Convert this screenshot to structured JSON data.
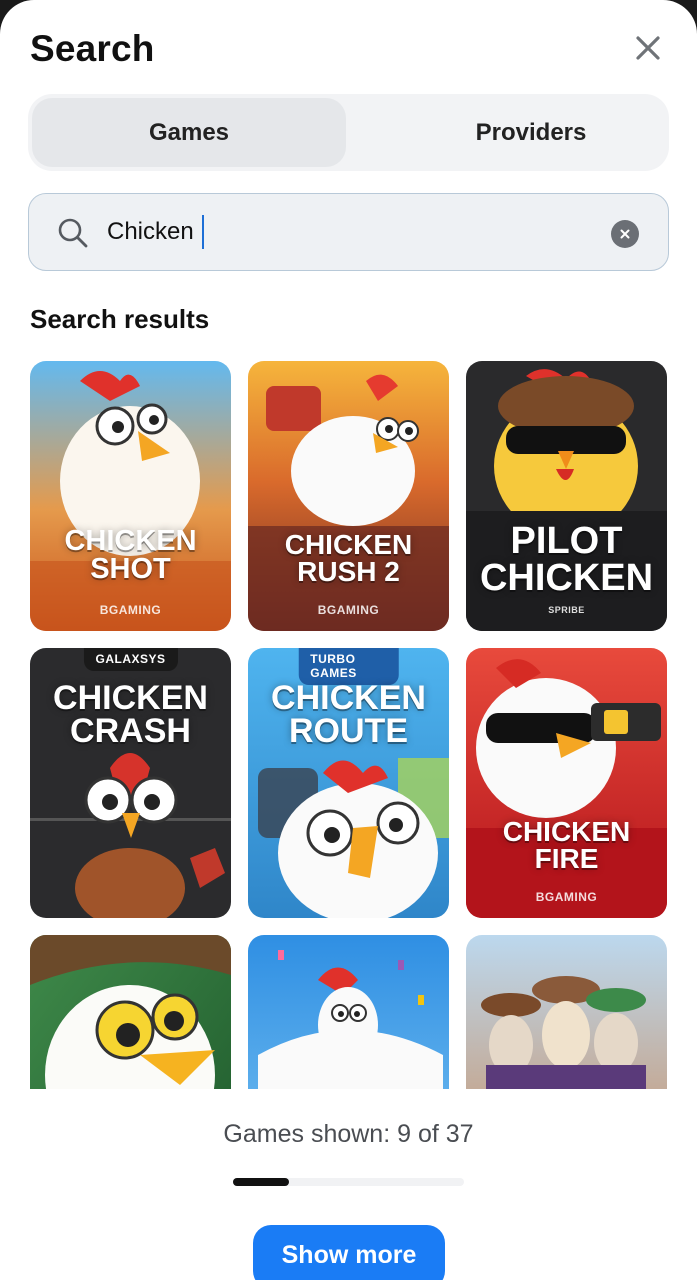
{
  "header": {
    "title": "Search",
    "close_icon": "close-icon"
  },
  "tabs": [
    {
      "label": "Games",
      "active": true
    },
    {
      "label": "Providers",
      "active": false
    }
  ],
  "search": {
    "value": "Chicken",
    "search_icon": "search-icon",
    "clear_icon": "clear-circle-icon"
  },
  "results": {
    "heading": "Search results",
    "games": [
      {
        "name": "CHICKEN\nSHOT",
        "provider": "BGAMING",
        "badge": ""
      },
      {
        "name": "CHICKEN\nRUSH 2",
        "provider": "BGAMING",
        "badge": ""
      },
      {
        "name": "PILOT\nCHICKEN",
        "provider": "SPRIBE",
        "badge": ""
      },
      {
        "name": "CHICKEN\nCRASH",
        "provider": "",
        "badge": "GALAXSYS"
      },
      {
        "name": "CHICKEN\nROUTE",
        "provider": "",
        "badge": "TURBO GAMES"
      },
      {
        "name": "CHICKEN\nFIRE",
        "provider": "BGAMING",
        "badge": ""
      },
      {
        "name": "",
        "provider": "",
        "badge": ""
      },
      {
        "name": "",
        "provider": "",
        "badge": ""
      },
      {
        "name": "",
        "provider": "",
        "badge": ""
      }
    ]
  },
  "footer": {
    "count_text": "Games shown: 9 of 37",
    "shown": 9,
    "total": 37,
    "show_more_label": "Show more"
  },
  "colors": {
    "accent": "#1a7cf5",
    "tab_active_bg": "#e5e7ea"
  }
}
